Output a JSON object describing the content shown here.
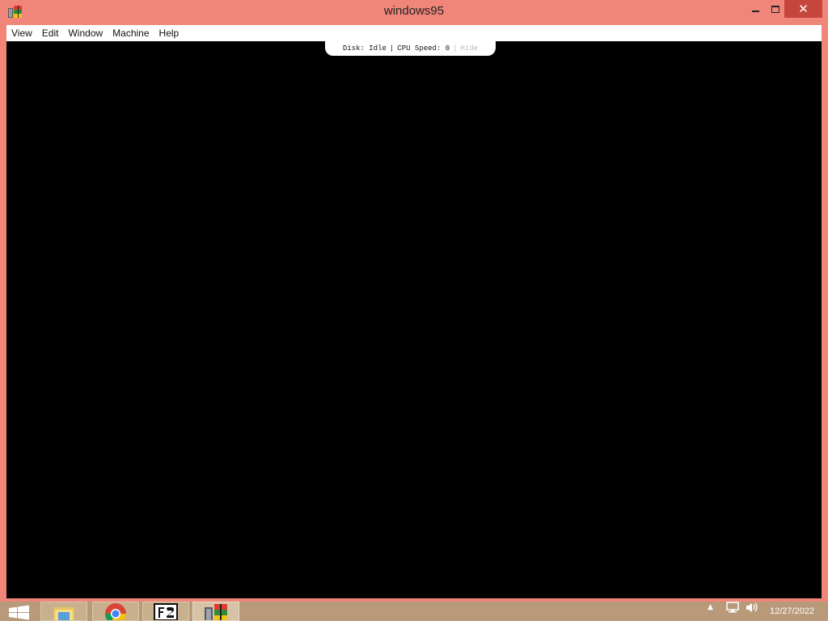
{
  "window": {
    "title": "windows95",
    "icon": "windows95-app-icon",
    "close_label": "✕"
  },
  "menu": {
    "items": [
      "View",
      "Edit",
      "Window",
      "Machine",
      "Help"
    ]
  },
  "status": {
    "disk": "Disk: Idle",
    "separator": "|",
    "cpu": "CPU Speed: 0",
    "hide": "Hide"
  },
  "taskbar": {
    "start_icon": "windows-logo-icon",
    "apps": [
      {
        "icon": "file-explorer-icon"
      },
      {
        "icon": "chrome-icon"
      },
      {
        "icon": "f2-app-icon"
      },
      {
        "icon": "windows95-app-icon",
        "active": true
      }
    ],
    "tray": {
      "arrow": "▲",
      "icons": [
        "network-icon",
        "volume-icon"
      ]
    },
    "clock": "12/27/2022"
  },
  "colors": {
    "frame": "#f0857a",
    "close_button": "#c7463c",
    "screen": "#000000",
    "taskbar": "#b89a7a"
  }
}
